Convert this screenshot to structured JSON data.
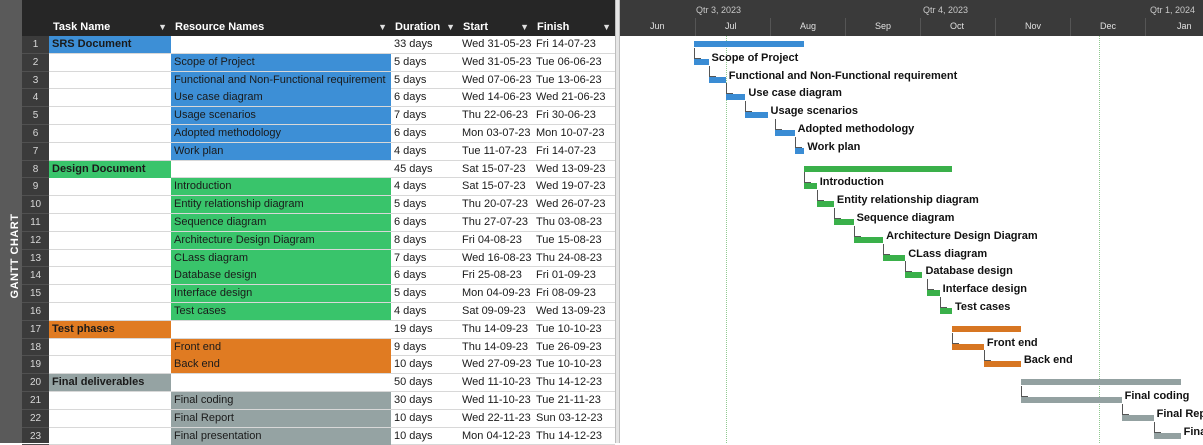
{
  "sidebar_label": "GANTT CHART",
  "columns": {
    "task_name": "Task Name",
    "resource_names": "Resource Names",
    "duration": "Duration",
    "start": "Start",
    "finish": "Finish"
  },
  "timeline": {
    "quarters": [
      "Qtr 3, 2023",
      "Qtr 4, 2023",
      "Qtr 1, 2024"
    ],
    "months": [
      "Jun",
      "Jul",
      "Aug",
      "Sep",
      "Oct",
      "Nov",
      "Dec",
      "Jan"
    ]
  },
  "colors": {
    "blue": "#3d8fd6",
    "green": "#39c46b",
    "orange": "#e07b22",
    "gray": "#95a3a3",
    "blue_bar": "#3a8cd4",
    "green_bar": "#3ab04a",
    "orange_bar": "#d77622",
    "gray_bar": "#93a1a1"
  },
  "rows": [
    {
      "id": "1",
      "task": "SRS Document",
      "resource": "",
      "duration": "33 days",
      "start": "Wed 31-05-23",
      "finish": "Fri 14-07-23",
      "group": "blue",
      "summary": true
    },
    {
      "id": "2",
      "task": "",
      "resource": "Scope of Project",
      "duration": "5 days",
      "start": "Wed 31-05-23",
      "finish": "Tue 06-06-23",
      "group": "blue",
      "summary": false
    },
    {
      "id": "3",
      "task": "",
      "resource": "Functional and Non-Functional requirement",
      "duration": "5 days",
      "start": "Wed 07-06-23",
      "finish": "Tue 13-06-23",
      "group": "blue",
      "summary": false
    },
    {
      "id": "4",
      "task": "",
      "resource": "Use case diagram",
      "duration": "6 days",
      "start": "Wed 14-06-23",
      "finish": "Wed 21-06-23",
      "group": "blue",
      "summary": false
    },
    {
      "id": "5",
      "task": "",
      "resource": "Usage scenarios",
      "duration": "7 days",
      "start": "Thu 22-06-23",
      "finish": "Fri 30-06-23",
      "group": "blue",
      "summary": false
    },
    {
      "id": "6",
      "task": "",
      "resource": "Adopted methodology",
      "duration": "6 days",
      "start": "Mon 03-07-23",
      "finish": "Mon 10-07-23",
      "group": "blue",
      "summary": false
    },
    {
      "id": "7",
      "task": "",
      "resource": "Work plan",
      "duration": "4 days",
      "start": "Tue 11-07-23",
      "finish": "Fri 14-07-23",
      "group": "blue",
      "summary": false
    },
    {
      "id": "8",
      "task": "Design Document",
      "resource": "",
      "duration": "45 days",
      "start": "Sat 15-07-23",
      "finish": "Wed 13-09-23",
      "group": "green",
      "summary": true
    },
    {
      "id": "9",
      "task": "",
      "resource": "Introduction",
      "duration": "4 days",
      "start": "Sat 15-07-23",
      "finish": "Wed 19-07-23",
      "group": "green",
      "summary": false
    },
    {
      "id": "10",
      "task": "",
      "resource": "Entity relationship diagram",
      "duration": "5 days",
      "start": "Thu 20-07-23",
      "finish": "Wed 26-07-23",
      "group": "green",
      "summary": false
    },
    {
      "id": "11",
      "task": "",
      "resource": "Sequence diagram",
      "duration": "6 days",
      "start": "Thu 27-07-23",
      "finish": "Thu 03-08-23",
      "group": "green",
      "summary": false
    },
    {
      "id": "12",
      "task": "",
      "resource": "Architecture Design Diagram",
      "duration": "8 days",
      "start": "Fri 04-08-23",
      "finish": "Tue 15-08-23",
      "group": "green",
      "summary": false
    },
    {
      "id": "13",
      "task": "",
      "resource": "CLass diagram",
      "duration": "7 days",
      "start": "Wed 16-08-23",
      "finish": "Thu 24-08-23",
      "group": "green",
      "summary": false
    },
    {
      "id": "14",
      "task": "",
      "resource": "Database design",
      "duration": "6 days",
      "start": "Fri 25-08-23",
      "finish": "Fri 01-09-23",
      "group": "green",
      "summary": false
    },
    {
      "id": "15",
      "task": "",
      "resource": "Interface design",
      "duration": "5 days",
      "start": "Mon 04-09-23",
      "finish": "Fri 08-09-23",
      "group": "green",
      "summary": false
    },
    {
      "id": "16",
      "task": "",
      "resource": "Test cases",
      "duration": "4 days",
      "start": "Sat 09-09-23",
      "finish": "Wed 13-09-23",
      "group": "green",
      "summary": false
    },
    {
      "id": "17",
      "task": "Test phases",
      "resource": "",
      "duration": "19 days",
      "start": "Thu 14-09-23",
      "finish": "Tue 10-10-23",
      "group": "orange",
      "summary": true
    },
    {
      "id": "18",
      "task": "",
      "resource": "Front end",
      "duration": "9 days",
      "start": "Thu 14-09-23",
      "finish": "Tue 26-09-23",
      "group": "orange",
      "summary": false
    },
    {
      "id": "19",
      "task": "",
      "resource": "Back end",
      "duration": "10 days",
      "start": "Wed 27-09-23",
      "finish": "Tue 10-10-23",
      "group": "orange",
      "summary": false
    },
    {
      "id": "20",
      "task": "Final deliverables",
      "resource": "",
      "duration": "50 days",
      "start": "Wed 11-10-23",
      "finish": "Thu 14-12-23",
      "group": "gray",
      "summary": true
    },
    {
      "id": "21",
      "task": "",
      "resource": "Final coding",
      "duration": "30 days",
      "start": "Wed 11-10-23",
      "finish": "Tue 21-11-23",
      "group": "gray",
      "summary": false
    },
    {
      "id": "22",
      "task": "",
      "resource": "Final Report",
      "duration": "10 days",
      "start": "Wed 22-11-23",
      "finish": "Sun 03-12-23",
      "group": "gray",
      "summary": false
    },
    {
      "id": "23",
      "task": "",
      "resource": "Final presentation",
      "duration": "10 days",
      "start": "Mon 04-12-23",
      "finish": "Thu 14-12-23",
      "group": "gray",
      "summary": false
    }
  ]
}
